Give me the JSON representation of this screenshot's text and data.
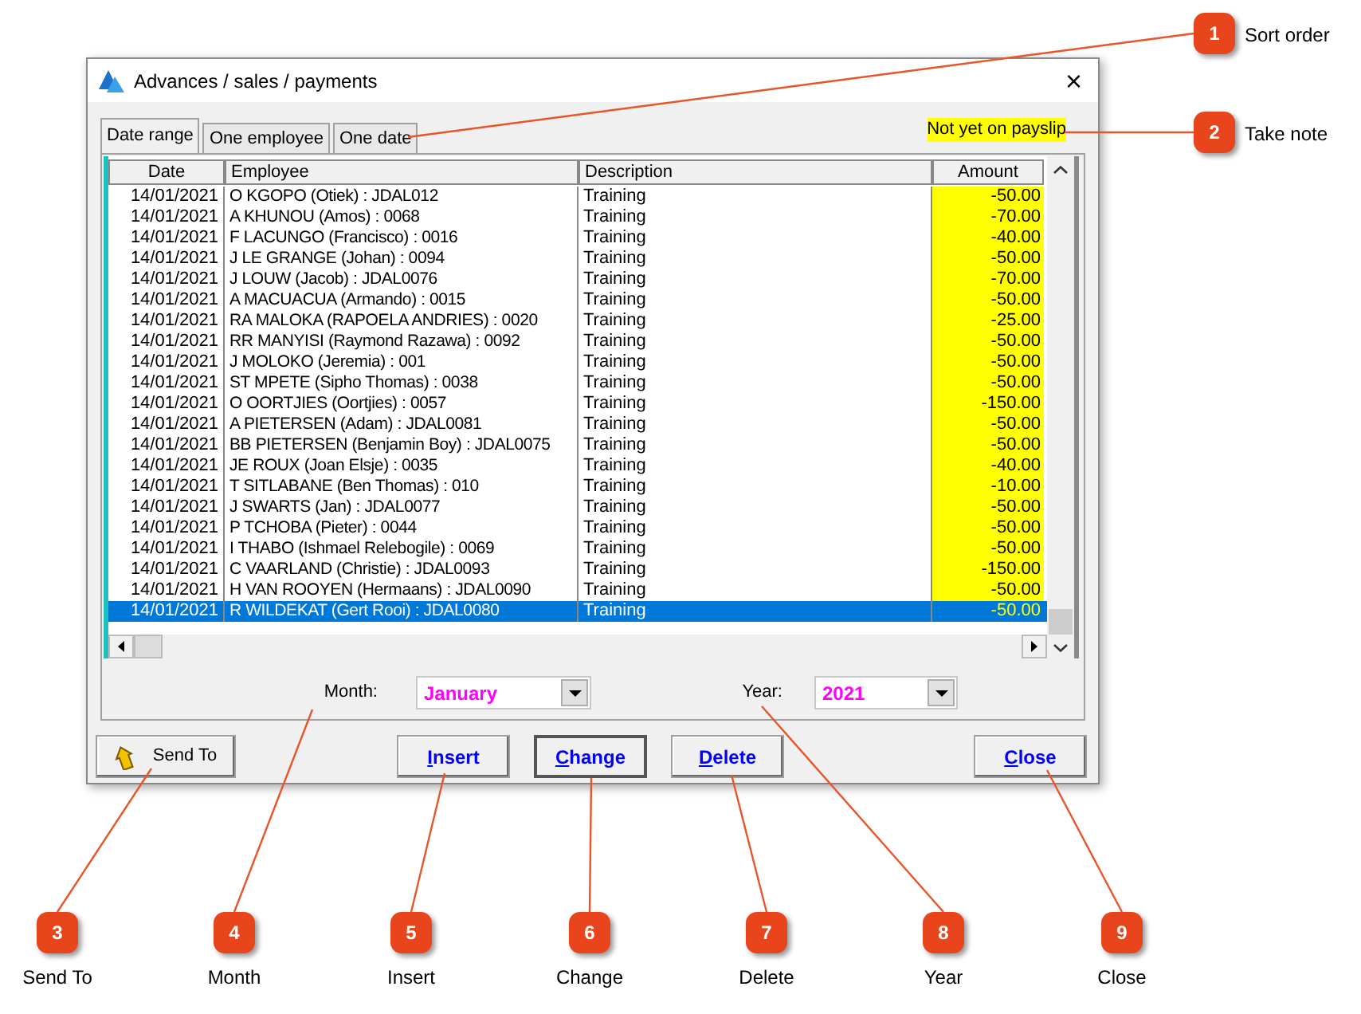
{
  "window": {
    "title": "Advances / sales / payments",
    "close": "×"
  },
  "tabs": [
    {
      "label": "Date range",
      "selected": true
    },
    {
      "label": "One employee",
      "selected": false
    },
    {
      "label": "One date",
      "selected": false
    }
  ],
  "status_label": "Not yet on payslip",
  "table": {
    "columns": [
      "Date",
      "Employee",
      "Description",
      "Amount"
    ],
    "rows": [
      {
        "date": "14/01/2021",
        "employee": "O KGOPO (Otiek) : JDAL012",
        "description": "Training",
        "amount": "-50.00",
        "selected": false
      },
      {
        "date": "14/01/2021",
        "employee": "A KHUNOU (Amos) : 0068",
        "description": "Training",
        "amount": "-70.00",
        "selected": false
      },
      {
        "date": "14/01/2021",
        "employee": "F LACUNGO (Francisco) : 0016",
        "description": "Training",
        "amount": "-40.00",
        "selected": false
      },
      {
        "date": "14/01/2021",
        "employee": "J LE GRANGE (Johan) : 0094",
        "description": "Training",
        "amount": "-50.00",
        "selected": false
      },
      {
        "date": "14/01/2021",
        "employee": "J LOUW (Jacob) : JDAL0076",
        "description": "Training",
        "amount": "-70.00",
        "selected": false
      },
      {
        "date": "14/01/2021",
        "employee": "A MACUACUA (Armando) : 0015",
        "description": "Training",
        "amount": "-50.00",
        "selected": false
      },
      {
        "date": "14/01/2021",
        "employee": "RA MALOKA (RAPOELA ANDRIES) : 0020",
        "description": "Training",
        "amount": "-25.00",
        "selected": false
      },
      {
        "date": "14/01/2021",
        "employee": "RR MANYISI (Raymond Razawa) : 0092",
        "description": "Training",
        "amount": "-50.00",
        "selected": false
      },
      {
        "date": "14/01/2021",
        "employee": "J MOLOKO (Jeremia) : 001",
        "description": "Training",
        "amount": "-50.00",
        "selected": false
      },
      {
        "date": "14/01/2021",
        "employee": "ST MPETE (Sipho Thomas) : 0038",
        "description": "Training",
        "amount": "-50.00",
        "selected": false
      },
      {
        "date": "14/01/2021",
        "employee": "O OORTJIES (Oortjies) : 0057",
        "description": "Training",
        "amount": "-150.00",
        "selected": false
      },
      {
        "date": "14/01/2021",
        "employee": "A PIETERSEN (Adam) : JDAL0081",
        "description": "Training",
        "amount": "-50.00",
        "selected": false
      },
      {
        "date": "14/01/2021",
        "employee": "BB PIETERSEN (Benjamin Boy) : JDAL0075",
        "description": "Training",
        "amount": "-50.00",
        "selected": false
      },
      {
        "date": "14/01/2021",
        "employee": "JE ROUX (Joan Elsje) : 0035",
        "description": "Training",
        "amount": "-40.00",
        "selected": false
      },
      {
        "date": "14/01/2021",
        "employee": "T SITLABANE (Ben Thomas) : 010",
        "description": "Training",
        "amount": "-10.00",
        "selected": false
      },
      {
        "date": "14/01/2021",
        "employee": "J SWARTS (Jan) : JDAL0077",
        "description": "Training",
        "amount": "-50.00",
        "selected": false
      },
      {
        "date": "14/01/2021",
        "employee": "P TCHOBA (Pieter) : 0044",
        "description": "Training",
        "amount": "-50.00",
        "selected": false
      },
      {
        "date": "14/01/2021",
        "employee": "I THABO (Ishmael Relebogile) : 0069",
        "description": "Training",
        "amount": "-50.00",
        "selected": false
      },
      {
        "date": "14/01/2021",
        "employee": "C VAARLAND (Christie) : JDAL0093",
        "description": "Training",
        "amount": "-150.00",
        "selected": false
      },
      {
        "date": "14/01/2021",
        "employee": "H VAN ROOYEN (Hermaans) : JDAL0090",
        "description": "Training",
        "amount": "-50.00",
        "selected": false
      },
      {
        "date": "14/01/2021",
        "employee": "R WILDEKAT (Gert Rooi) : JDAL0080",
        "description": "Training",
        "amount": "-50.00",
        "selected": true
      }
    ]
  },
  "filters": [
    {
      "label": "Month:",
      "value": "January"
    },
    {
      "label": "Year:",
      "value": "2021"
    }
  ],
  "buttons": [
    {
      "label": "Send To",
      "kind": "icon",
      "default": false
    },
    {
      "label": "Insert",
      "kind": "command",
      "default": false
    },
    {
      "label": "Change",
      "kind": "command",
      "default": true
    },
    {
      "label": "Delete",
      "kind": "command",
      "default": false
    },
    {
      "label": "Close",
      "kind": "command",
      "default": false
    }
  ],
  "callouts": [
    {
      "number": "1",
      "label": "Sort order"
    },
    {
      "number": "2",
      "label": "Take note"
    },
    {
      "number": "3",
      "label": "Send To"
    },
    {
      "number": "4",
      "label": "Month"
    },
    {
      "number": "5",
      "label": "Insert"
    },
    {
      "number": "6",
      "label": "Change"
    },
    {
      "number": "7",
      "label": "Delete"
    },
    {
      "number": "8",
      "label": "Year"
    },
    {
      "number": "9",
      "label": "Close"
    }
  ]
}
